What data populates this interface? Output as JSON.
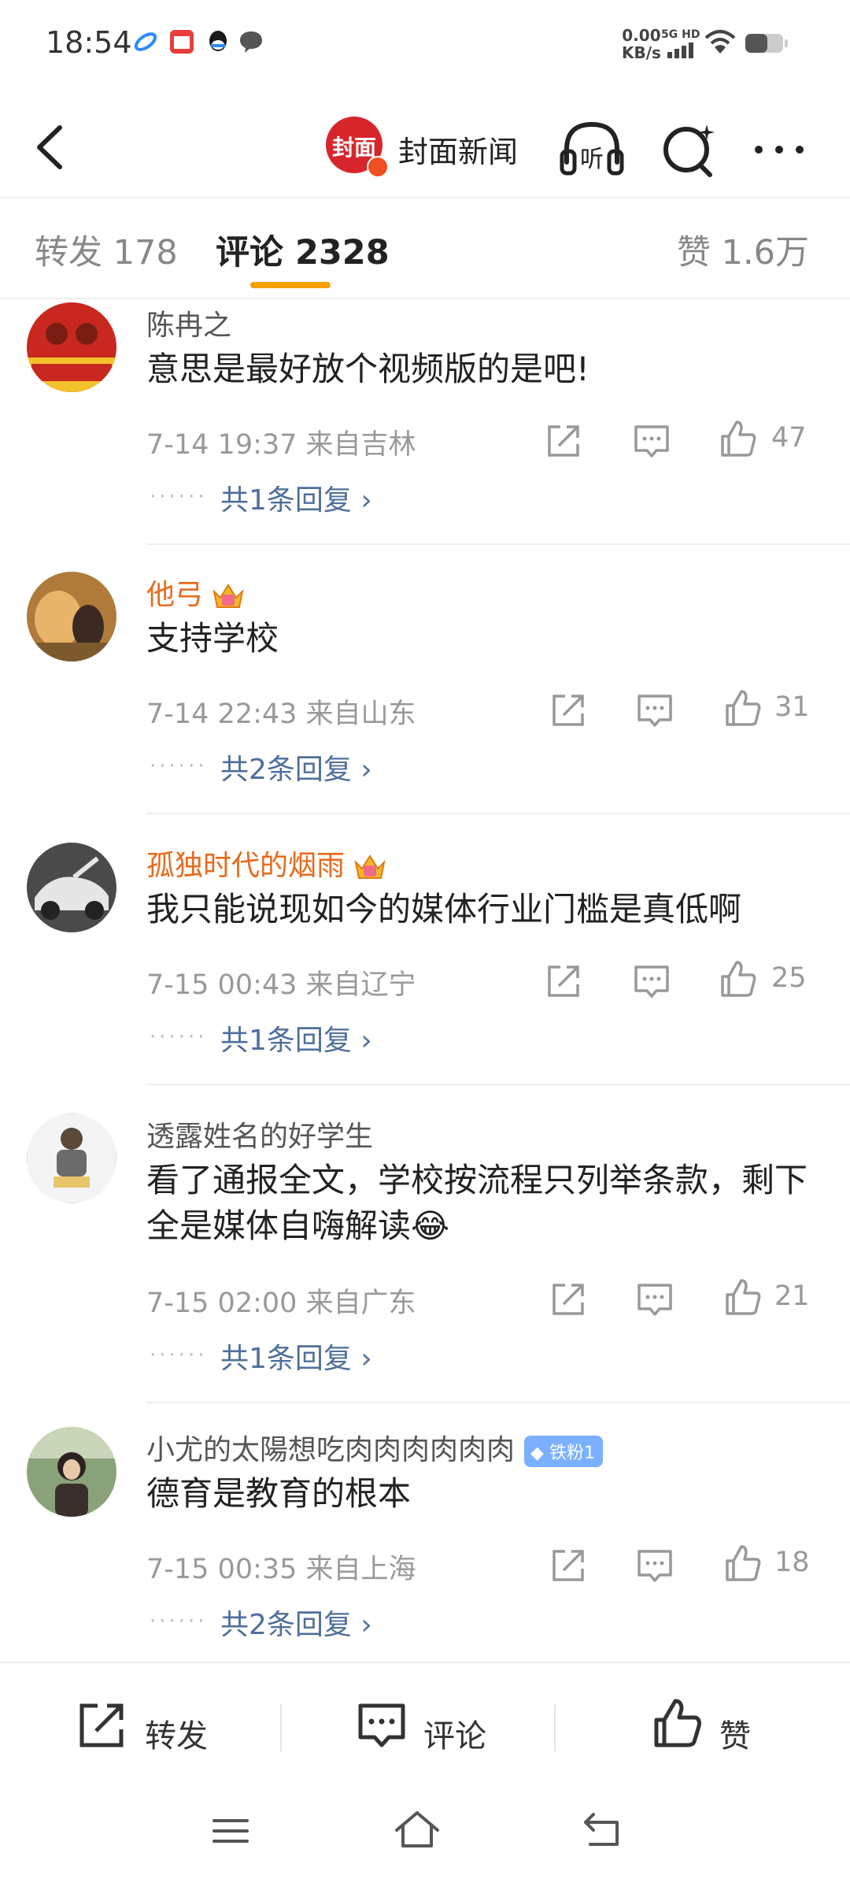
{
  "status_bar": {
    "time": "18:54",
    "net_speed_value": "0.00",
    "net_speed_unit": "KB/s",
    "network": "5G HD"
  },
  "header": {
    "logo_text": "封面",
    "account_name": "封面新闻",
    "listen_label": "听"
  },
  "tabs": {
    "repost": "转发 178",
    "comments": "评论 2328",
    "likes": "赞 1.6万"
  },
  "comments": [
    {
      "name": "陈冉之",
      "vip": false,
      "text": "意思是最好放个视频版的是吧!",
      "meta": "7-14 19:37  来自吉林",
      "likes": "47",
      "replies": "共1条回复 ›"
    },
    {
      "name": "他弓",
      "vip": true,
      "text": "支持学校",
      "meta": "7-14 22:43  来自山东",
      "likes": "31",
      "replies": "共2条回复 ›"
    },
    {
      "name": "孤独时代的烟雨",
      "vip": true,
      "text": "我只能说现如今的媒体行业门槛是真低啊",
      "meta": "7-15 00:43  来自辽宁",
      "likes": "25",
      "replies": "共1条回复 ›"
    },
    {
      "name": "透露姓名的好学生",
      "vip": false,
      "text": "看了通报全文，学校按流程只列举条款，剩下全是媒体自嗨解读😂",
      "meta": "7-15 02:00  来自广东",
      "likes": "21",
      "replies": "共1条回复 ›"
    },
    {
      "name": "小尤的太陽想吃肉肉肉肉肉肉",
      "vip": false,
      "badge": "铁粉1",
      "text": "德育是教育的根本",
      "meta": "7-15 00:35  来自上海",
      "likes": "18",
      "replies": "共2条回复 ›"
    }
  ],
  "bottom_bar": {
    "repost": "转发",
    "comment": "评论",
    "like": "赞"
  },
  "icons": [
    "back-icon",
    "listen-icon",
    "search-icon",
    "more-icon",
    "share-icon",
    "comment-icon",
    "like-icon",
    "menu-icon",
    "home-icon",
    "return-icon"
  ],
  "colors": {
    "accent": "#f5a200",
    "vip_name": "#e86a1a",
    "reply_link": "#4f6f9c",
    "brand_red": "#d7262b"
  }
}
